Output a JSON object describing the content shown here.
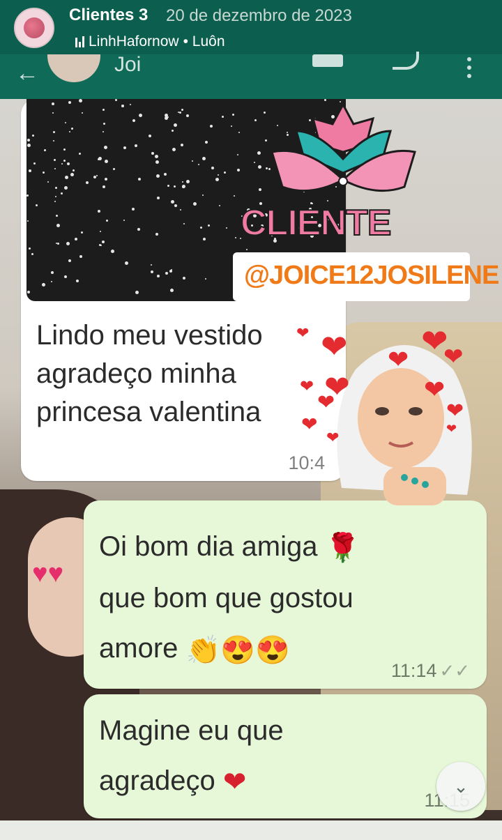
{
  "story": {
    "title": "Clientes 3",
    "date": "20 de dezembro de 2023",
    "music": "LinhHafornow",
    "music_suffix": "• Luôn"
  },
  "chat": {
    "contact_name": "Joi"
  },
  "messages": [
    {
      "direction": "in",
      "text": "Lindo meu vestido agradeço  minha princesa valentina",
      "time": "10:4"
    },
    {
      "direction": "out",
      "text": "Oi bom dia amiga",
      "text2": "que bom que gostou",
      "text3": "amore",
      "emoji": [
        "rose-emoji",
        "clapping-emoji",
        "heart-eyes-emoji"
      ],
      "time": "11:14"
    },
    {
      "direction": "out",
      "text": "Magine eu que",
      "text2": "agradeço",
      "time": "11:15"
    }
  ],
  "sticker": {
    "title": "CLIENTE LINDA",
    "handle": "@JOICE12JOSILENE"
  },
  "colors": {
    "header": "#0c5f4e",
    "bubble_out": "#e7f8d9",
    "bubble_in": "#ffffff",
    "logo_pink": "#ef7aa2",
    "handle_orange": "#f07a17"
  }
}
